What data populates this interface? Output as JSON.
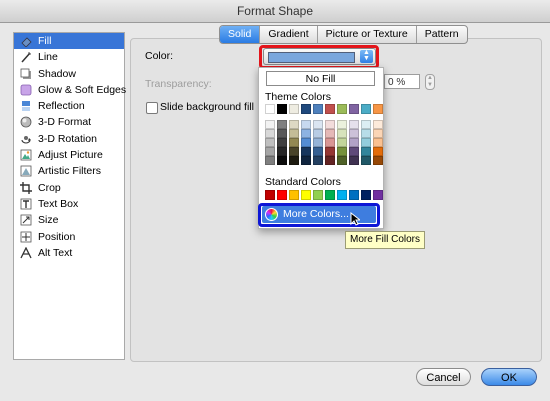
{
  "window": {
    "title": "Format Shape"
  },
  "sidebar": {
    "items": [
      {
        "label": "Fill",
        "icon": "fill-icon",
        "selected": true
      },
      {
        "label": "Line",
        "icon": "line-icon"
      },
      {
        "label": "Shadow",
        "icon": "shadow-icon"
      },
      {
        "label": "Glow & Soft Edges",
        "icon": "glow-icon"
      },
      {
        "label": "Reflection",
        "icon": "reflection-icon"
      },
      {
        "label": "3-D Format",
        "icon": "3d-format-icon"
      },
      {
        "label": "3-D Rotation",
        "icon": "3d-rotation-icon"
      },
      {
        "label": "Adjust Picture",
        "icon": "adjust-picture-icon"
      },
      {
        "label": "Artistic Filters",
        "icon": "artistic-filters-icon"
      },
      {
        "label": "Crop",
        "icon": "crop-icon"
      },
      {
        "label": "Text Box",
        "icon": "text-box-icon"
      },
      {
        "label": "Size",
        "icon": "size-icon"
      },
      {
        "label": "Position",
        "icon": "position-icon"
      },
      {
        "label": "Alt Text",
        "icon": "alt-text-icon"
      }
    ]
  },
  "tabs": [
    {
      "label": "Solid",
      "active": true
    },
    {
      "label": "Gradient"
    },
    {
      "label": "Picture or Texture"
    },
    {
      "label": "Pattern"
    }
  ],
  "fill": {
    "color_label": "Color:",
    "color_value": "#7aa7dd",
    "transparency_label": "Transparency:",
    "transparency_value": "0 %",
    "slide_bg_label": "Slide background fill"
  },
  "popup": {
    "no_fill": "No Fill",
    "theme_title": "Theme Colors",
    "theme_top": [
      "#ffffff",
      "#000000",
      "#eeece1",
      "#1f497d",
      "#4f81bd",
      "#c0504d",
      "#9bbb59",
      "#8064a2",
      "#4bacc6",
      "#f79646"
    ],
    "theme_shades": [
      [
        "#f2f2f2",
        "#d8d8d8",
        "#bfbfbf",
        "#a5a5a5",
        "#7f7f7f"
      ],
      [
        "#7f7f7f",
        "#595959",
        "#3f3f3f",
        "#262626",
        "#0c0c0c"
      ],
      [
        "#ddd9c3",
        "#c4bd97",
        "#938953",
        "#494429",
        "#1d1b10"
      ],
      [
        "#c6d9f0",
        "#8db3e2",
        "#548dd4",
        "#17365d",
        "#0f243e"
      ],
      [
        "#dbe5f1",
        "#b8cce4",
        "#95b3d7",
        "#366092",
        "#244061"
      ],
      [
        "#f2dcdb",
        "#e5b9b7",
        "#d99694",
        "#953734",
        "#632423"
      ],
      [
        "#ebf1dd",
        "#d7e3bc",
        "#c3d69b",
        "#76923c",
        "#4f6128"
      ],
      [
        "#e5e0ec",
        "#ccc1d9",
        "#b2a2c7",
        "#5f497a",
        "#3f3151"
      ],
      [
        "#dbeef3",
        "#b7dde8",
        "#92cddc",
        "#31859b",
        "#205867"
      ],
      [
        "#fdeada",
        "#fbd5b5",
        "#fac08f",
        "#e36c09",
        "#974806"
      ]
    ],
    "standard_title": "Standard Colors",
    "standard": [
      "#c00000",
      "#ff0000",
      "#ffc000",
      "#ffff00",
      "#92d050",
      "#00b050",
      "#00b0f0",
      "#0070c0",
      "#002060",
      "#7030a0"
    ],
    "more_colors": "More Colors..."
  },
  "tooltip": "More Fill Colors",
  "buttons": {
    "cancel": "Cancel",
    "ok": "OK"
  }
}
